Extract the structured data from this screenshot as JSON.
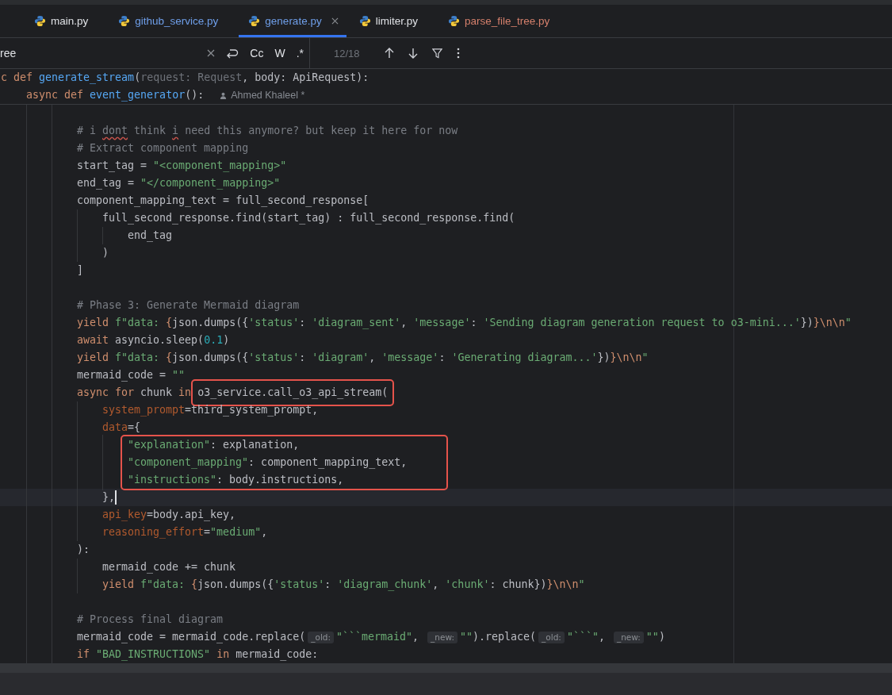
{
  "tabs": [
    {
      "label": "main.py",
      "color": "#dfe1e5",
      "selected": false
    },
    {
      "label": "github_service.py",
      "color": "#6f9fea",
      "selected": false
    },
    {
      "label": "generate.py",
      "color": "#6f9fea",
      "selected": true
    },
    {
      "label": "limiter.py",
      "color": "#dfe1e5",
      "selected": false
    },
    {
      "label": "parse_file_tree.py",
      "color": "#d5806c",
      "selected": false
    }
  ],
  "find_bar": {
    "value": "ree",
    "toggles": [
      {
        "label": "Cc",
        "on": false
      },
      {
        "label": "W",
        "on": false
      },
      {
        "label": ".*",
        "on": false
      }
    ],
    "match_count": "12/18"
  },
  "sticky_lines": [
    {
      "tokens": [
        {
          "kind": "kw",
          "text": "c def "
        },
        {
          "kind": "fn",
          "text": "generate_stream"
        },
        {
          "kind": "plain",
          "text": "("
        },
        {
          "kind": "unused",
          "text": "request: Request"
        },
        {
          "kind": "plain",
          "text": ", body: ApiRequest):"
        }
      ],
      "children": [
        {
          "tokens": [
            {
              "kind": "kw",
              "text": "async def "
            },
            {
              "kind": "fn",
              "text": "event_generator"
            },
            {
              "kind": "plain",
              "text": "():"
            },
            {
              "kind": "author",
              "text": "Ahmed Khaleel *"
            }
          ]
        }
      ]
    }
  ],
  "lines": [
    {
      "gap_before": true,
      "tokens": [
        {
          "kind": "cmt",
          "text": "# i "
        },
        {
          "kind": "typo",
          "text": "dont"
        },
        {
          "kind": "cmt",
          "text": " think "
        },
        {
          "kind": "typo",
          "text": "i"
        },
        {
          "kind": "cmt",
          "text": " need this anymore? but keep it here for now"
        }
      ]
    },
    {
      "tokens": [
        {
          "kind": "cmt",
          "text": "# Extract component mapping"
        }
      ]
    },
    {
      "tokens": [
        {
          "kind": "plain",
          "text": "start_tag = "
        },
        {
          "kind": "str",
          "text": "\"<component_mapping>\""
        }
      ]
    },
    {
      "tokens": [
        {
          "kind": "plain",
          "text": "end_tag = "
        },
        {
          "kind": "str",
          "text": "\"</component_mapping>\""
        }
      ]
    },
    {
      "tokens": [
        {
          "kind": "plain",
          "text": "component_mapping_text = full_second_response["
        }
      ],
      "children": [
        {
          "tokens": [
            {
              "kind": "plain",
              "text": "full_second_response.find(start_tag) : full_second_response.find("
            }
          ],
          "children": [
            {
              "tokens": [
                {
                  "kind": "plain",
                  "text": "end_tag"
                }
              ]
            }
          ]
        },
        {
          "tokens": [
            {
              "kind": "plain",
              "text": ")"
            }
          ]
        }
      ]
    },
    {
      "tokens": [
        {
          "kind": "plain",
          "text": "]"
        }
      ]
    },
    {
      "gap_before": true,
      "tokens": [
        {
          "kind": "cmt",
          "text": "# Phase 3: Generate Mermaid diagram"
        }
      ]
    },
    {
      "tokens": [
        {
          "kind": "kw",
          "text": "yield "
        },
        {
          "kind": "str",
          "text": "f\"data: "
        },
        {
          "kind": "esc",
          "text": "{"
        },
        {
          "kind": "plain",
          "text": "json.dumps({"
        },
        {
          "kind": "str",
          "text": "'status'"
        },
        {
          "kind": "plain",
          "text": ": "
        },
        {
          "kind": "str",
          "text": "'diagram_sent'"
        },
        {
          "kind": "plain",
          "text": ", "
        },
        {
          "kind": "str",
          "text": "'message'"
        },
        {
          "kind": "plain",
          "text": ": "
        },
        {
          "kind": "str",
          "text": "'Sending diagram generation request to o3-mini...'"
        },
        {
          "kind": "plain",
          "text": "})"
        },
        {
          "kind": "esc",
          "text": "}\\n\\n"
        },
        {
          "kind": "str",
          "text": "\""
        }
      ]
    },
    {
      "tokens": [
        {
          "kind": "kw",
          "text": "await "
        },
        {
          "kind": "plain",
          "text": "asyncio.sleep("
        },
        {
          "kind": "num",
          "text": "0.1"
        },
        {
          "kind": "plain",
          "text": ")"
        }
      ]
    },
    {
      "tokens": [
        {
          "kind": "kw",
          "text": "yield "
        },
        {
          "kind": "str",
          "text": "f\"data: "
        },
        {
          "kind": "esc",
          "text": "{"
        },
        {
          "kind": "plain",
          "text": "json.dumps({"
        },
        {
          "kind": "str",
          "text": "'status'"
        },
        {
          "kind": "plain",
          "text": ": "
        },
        {
          "kind": "str",
          "text": "'diagram'"
        },
        {
          "kind": "plain",
          "text": ", "
        },
        {
          "kind": "str",
          "text": "'message'"
        },
        {
          "kind": "plain",
          "text": ": "
        },
        {
          "kind": "str",
          "text": "'Generating diagram...'"
        },
        {
          "kind": "plain",
          "text": "})"
        },
        {
          "kind": "esc",
          "text": "}\\n\\n"
        },
        {
          "kind": "str",
          "text": "\""
        }
      ]
    },
    {
      "tokens": [
        {
          "kind": "plain",
          "text": "mermaid_code = "
        },
        {
          "kind": "str",
          "text": "\"\""
        }
      ]
    },
    {
      "tokens": [
        {
          "kind": "kw",
          "text": "async for "
        },
        {
          "kind": "plain",
          "text": "chunk "
        },
        {
          "kind": "kw",
          "text": "in "
        },
        {
          "kind": "plain",
          "text": "o3_service.call_o3_api_stream(",
          "outlined": true
        }
      ],
      "children": [
        {
          "tokens": [
            {
              "kind": "arg",
              "text": "system_prompt"
            },
            {
              "kind": "plain",
              "text": "=third_system_prompt,"
            }
          ]
        },
        {
          "tokens": [
            {
              "kind": "arg",
              "text": "data"
            },
            {
              "kind": "plain",
              "text": "={"
            }
          ],
          "children": [
            {
              "kind": "group",
              "outlined": true,
              "children": [
                {
                  "tokens": [
                    {
                      "kind": "str",
                      "text": "\"explanation\""
                    },
                    {
                      "kind": "plain",
                      "text": ": explanation,"
                    }
                  ]
                },
                {
                  "tokens": [
                    {
                      "kind": "str",
                      "text": "\"component_mapping\""
                    },
                    {
                      "kind": "plain",
                      "text": ": component_mapping_text,"
                    }
                  ]
                },
                {
                  "tokens": [
                    {
                      "kind": "str",
                      "text": "\"instructions\""
                    },
                    {
                      "kind": "plain",
                      "text": ": body.instructions,"
                    }
                  ]
                }
              ]
            }
          ]
        },
        {
          "tokens": [
            {
              "kind": "plain",
              "text": "},"
            }
          ],
          "current": true
        },
        {
          "tokens": [
            {
              "kind": "arg",
              "text": "api_key"
            },
            {
              "kind": "plain",
              "text": "=body.api_key,"
            }
          ]
        },
        {
          "tokens": [
            {
              "kind": "arg",
              "text": "reasoning_effort"
            },
            {
              "kind": "plain",
              "text": "="
            },
            {
              "kind": "str",
              "text": "\"medium\""
            },
            {
              "kind": "plain",
              "text": ","
            }
          ]
        }
      ]
    },
    {
      "tokens": [
        {
          "kind": "plain",
          "text": "):"
        }
      ],
      "children": [
        {
          "tokens": [
            {
              "kind": "plain",
              "text": "mermaid_code += chunk"
            }
          ]
        },
        {
          "tokens": [
            {
              "kind": "kw",
              "text": "yield "
            },
            {
              "kind": "str",
              "text": "f\"data: "
            },
            {
              "kind": "esc",
              "text": "{"
            },
            {
              "kind": "plain",
              "text": "json.dumps({"
            },
            {
              "kind": "str",
              "text": "'status'"
            },
            {
              "kind": "plain",
              "text": ": "
            },
            {
              "kind": "str",
              "text": "'diagram_chunk'"
            },
            {
              "kind": "plain",
              "text": ", "
            },
            {
              "kind": "str",
              "text": "'chunk'"
            },
            {
              "kind": "plain",
              "text": ": chunk})"
            },
            {
              "kind": "esc",
              "text": "}\\n\\n"
            },
            {
              "kind": "str",
              "text": "\""
            }
          ]
        }
      ]
    },
    {
      "gap_before": true,
      "tokens": [
        {
          "kind": "cmt",
          "text": "# Process final diagram"
        }
      ]
    },
    {
      "tokens": [
        {
          "kind": "plain",
          "text": "mermaid_code = mermaid_code.replace("
        },
        {
          "kind": "hint",
          "text": "_old:"
        },
        {
          "kind": "str",
          "text": "\"```mermaid\""
        },
        {
          "kind": "plain",
          "text": ", "
        },
        {
          "kind": "hint",
          "text": "_new:"
        },
        {
          "kind": "str",
          "text": "\"\""
        },
        {
          "kind": "plain",
          "text": ").replace("
        },
        {
          "kind": "hint",
          "text": "_old:"
        },
        {
          "kind": "str",
          "text": "\"```\""
        },
        {
          "kind": "plain",
          "text": ", "
        },
        {
          "kind": "hint",
          "text": "_new:"
        },
        {
          "kind": "str",
          "text": "\"\""
        },
        {
          "kind": "plain",
          "text": ")"
        }
      ]
    },
    {
      "tokens": [
        {
          "kind": "kw",
          "text": "if "
        },
        {
          "kind": "str",
          "text": "\"BAD_INSTRUCTIONS\""
        },
        {
          "kind": "kw",
          "text": " in "
        },
        {
          "kind": "plain",
          "text": "mermaid_code:"
        }
      ]
    }
  ]
}
